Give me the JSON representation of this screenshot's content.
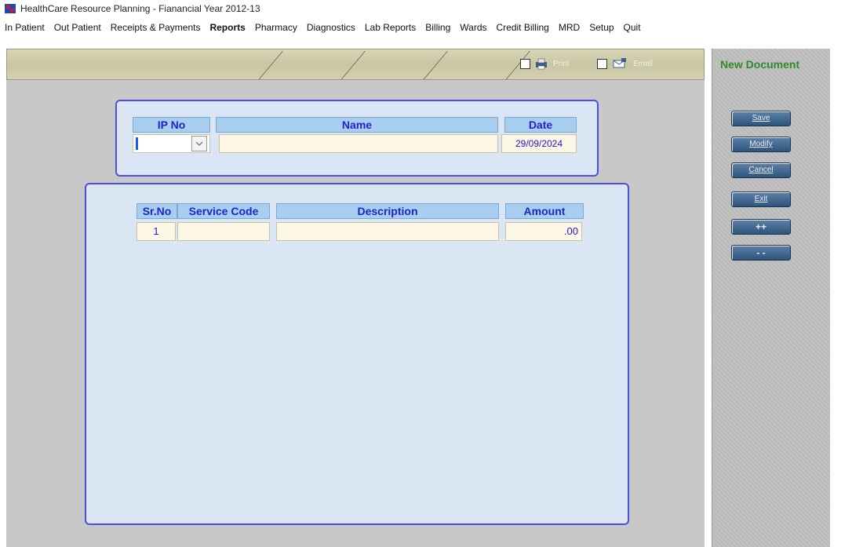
{
  "window": {
    "title": "HealthCare Resource Planning - Fianancial Year 2012-13"
  },
  "menu": {
    "items": [
      {
        "label": "In Patient"
      },
      {
        "label": "Out Patient"
      },
      {
        "label": "Receipts & Payments"
      },
      {
        "label": "Reports"
      },
      {
        "label": "Pharmacy"
      },
      {
        "label": "Diagnostics"
      },
      {
        "label": "Lab Reports"
      },
      {
        "label": "Billing"
      },
      {
        "label": "Wards"
      },
      {
        "label": "Credit Billing"
      },
      {
        "label": "MRD"
      },
      {
        "label": "Setup"
      },
      {
        "label": "Quit"
      }
    ],
    "active_index": 3
  },
  "toolbar": {
    "print_label": "Print",
    "email_label": "Email"
  },
  "side_panel": {
    "status": "New Document",
    "buttons": {
      "save": "Save",
      "modify": "Modify",
      "cancel": "Cancel",
      "exit": "Exit",
      "add_row": "++",
      "remove_row": "- -"
    }
  },
  "header_form": {
    "columns": {
      "ip_no": "IP No",
      "name": "Name",
      "date": "Date"
    },
    "values": {
      "ip_no": "",
      "name": "",
      "date": "29/09/2024"
    }
  },
  "items_table": {
    "columns": {
      "sr_no": "Sr.No",
      "service_code": "Service Code",
      "description": "Description",
      "amount": "Amount"
    },
    "rows": [
      {
        "sr_no": "1",
        "service_code": "",
        "description": "",
        "amount": ".00"
      }
    ]
  },
  "colors": {
    "panel_border": "#4a4fe0",
    "header_text": "#2222cc",
    "new_document": "#2d8a2d",
    "button": "#2f557d"
  }
}
